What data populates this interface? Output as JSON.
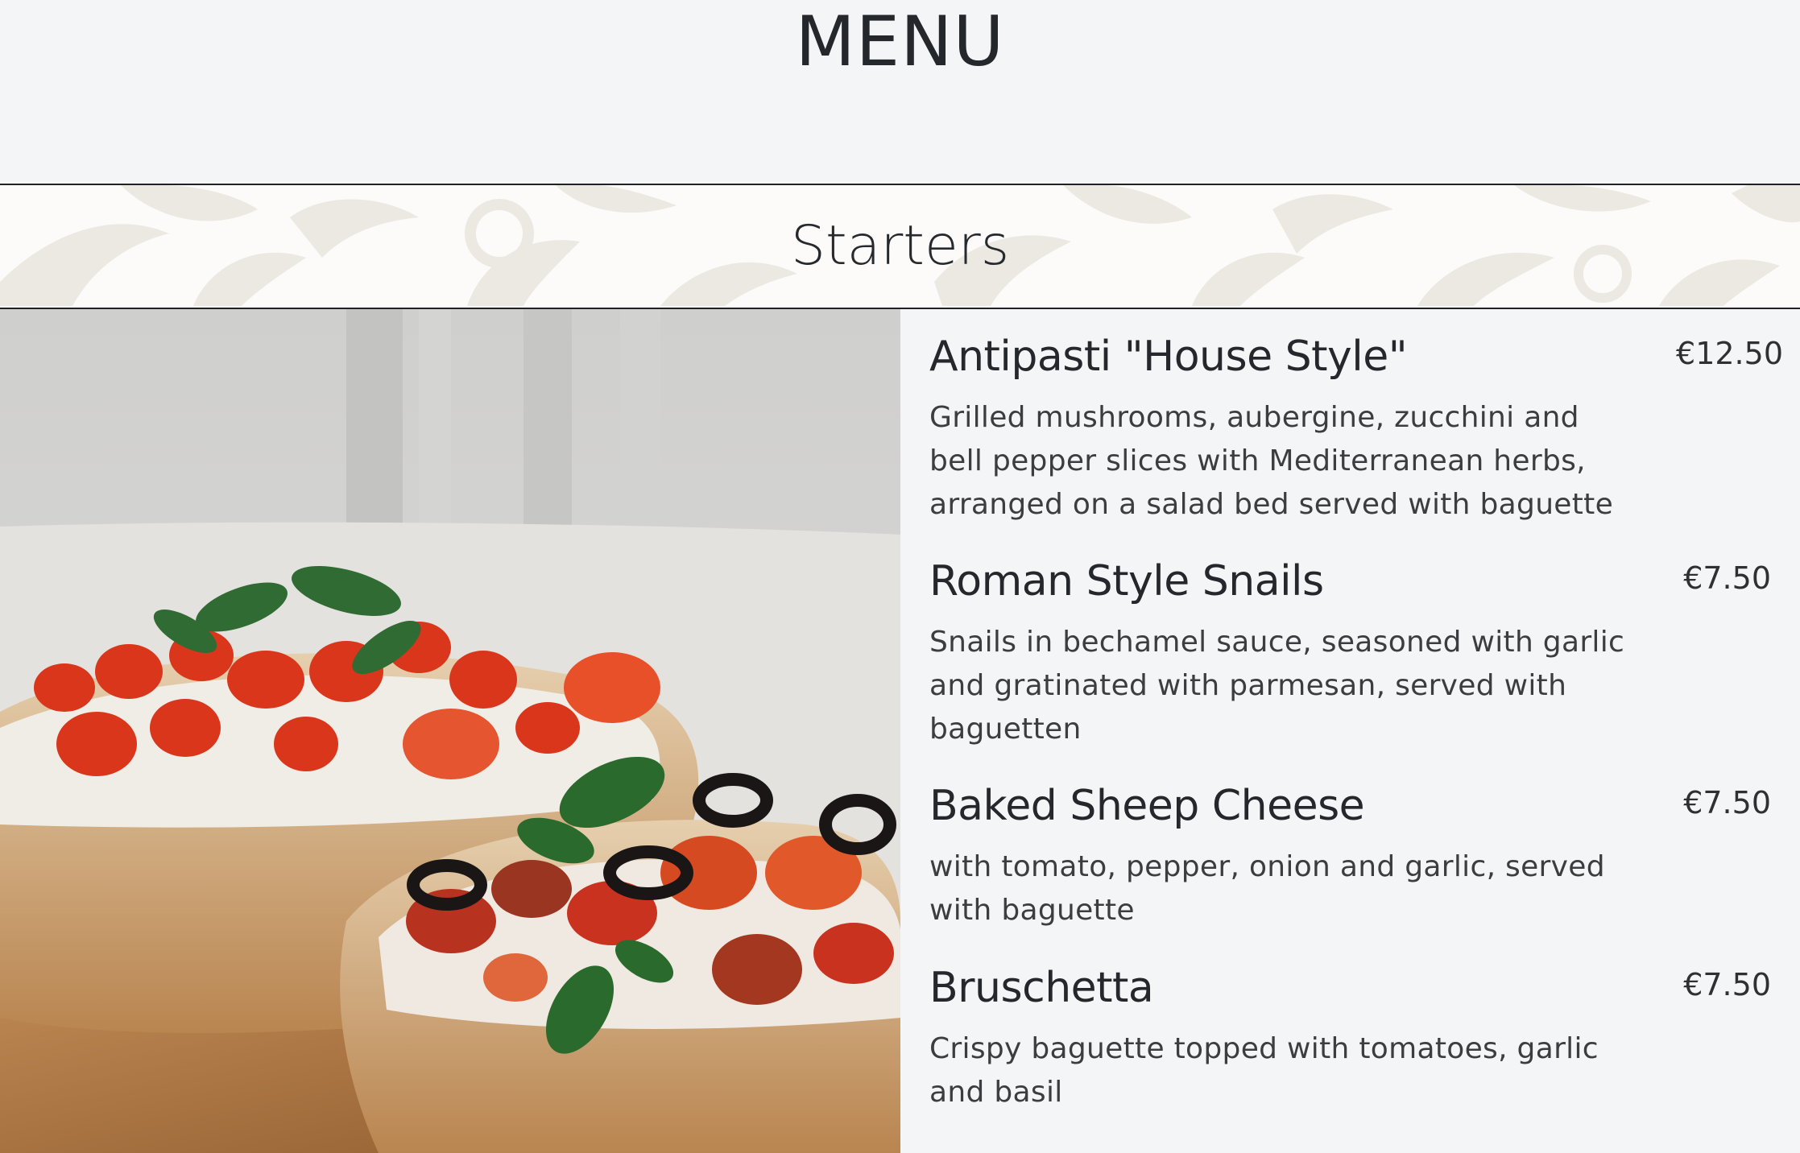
{
  "header": {
    "title": "MENU"
  },
  "section": {
    "title": "Starters"
  },
  "photo": {
    "subject": "bruschetta-photo"
  },
  "items": [
    {
      "name": "Antipasti \"House Style\"",
      "price": "€12.50",
      "description": "Grilled mushrooms, aubergine, zucchini and bell pepper slices with Mediterranean herbs, arranged on a salad bed served with baguette"
    },
    {
      "name": "Roman Style Snails",
      "price": "€7.50",
      "description": "Snails in bechamel sauce, seasoned with garlic and gratinated with parmesan, served with baguetten"
    },
    {
      "name": "Baked Sheep Cheese",
      "price": "€7.50",
      "description": "with tomato, pepper, onion and garlic, served with baguette"
    },
    {
      "name": "Bruschetta",
      "price": "€7.50",
      "description": "Crispy baguette topped with tomatoes, garlic and basil"
    }
  ]
}
